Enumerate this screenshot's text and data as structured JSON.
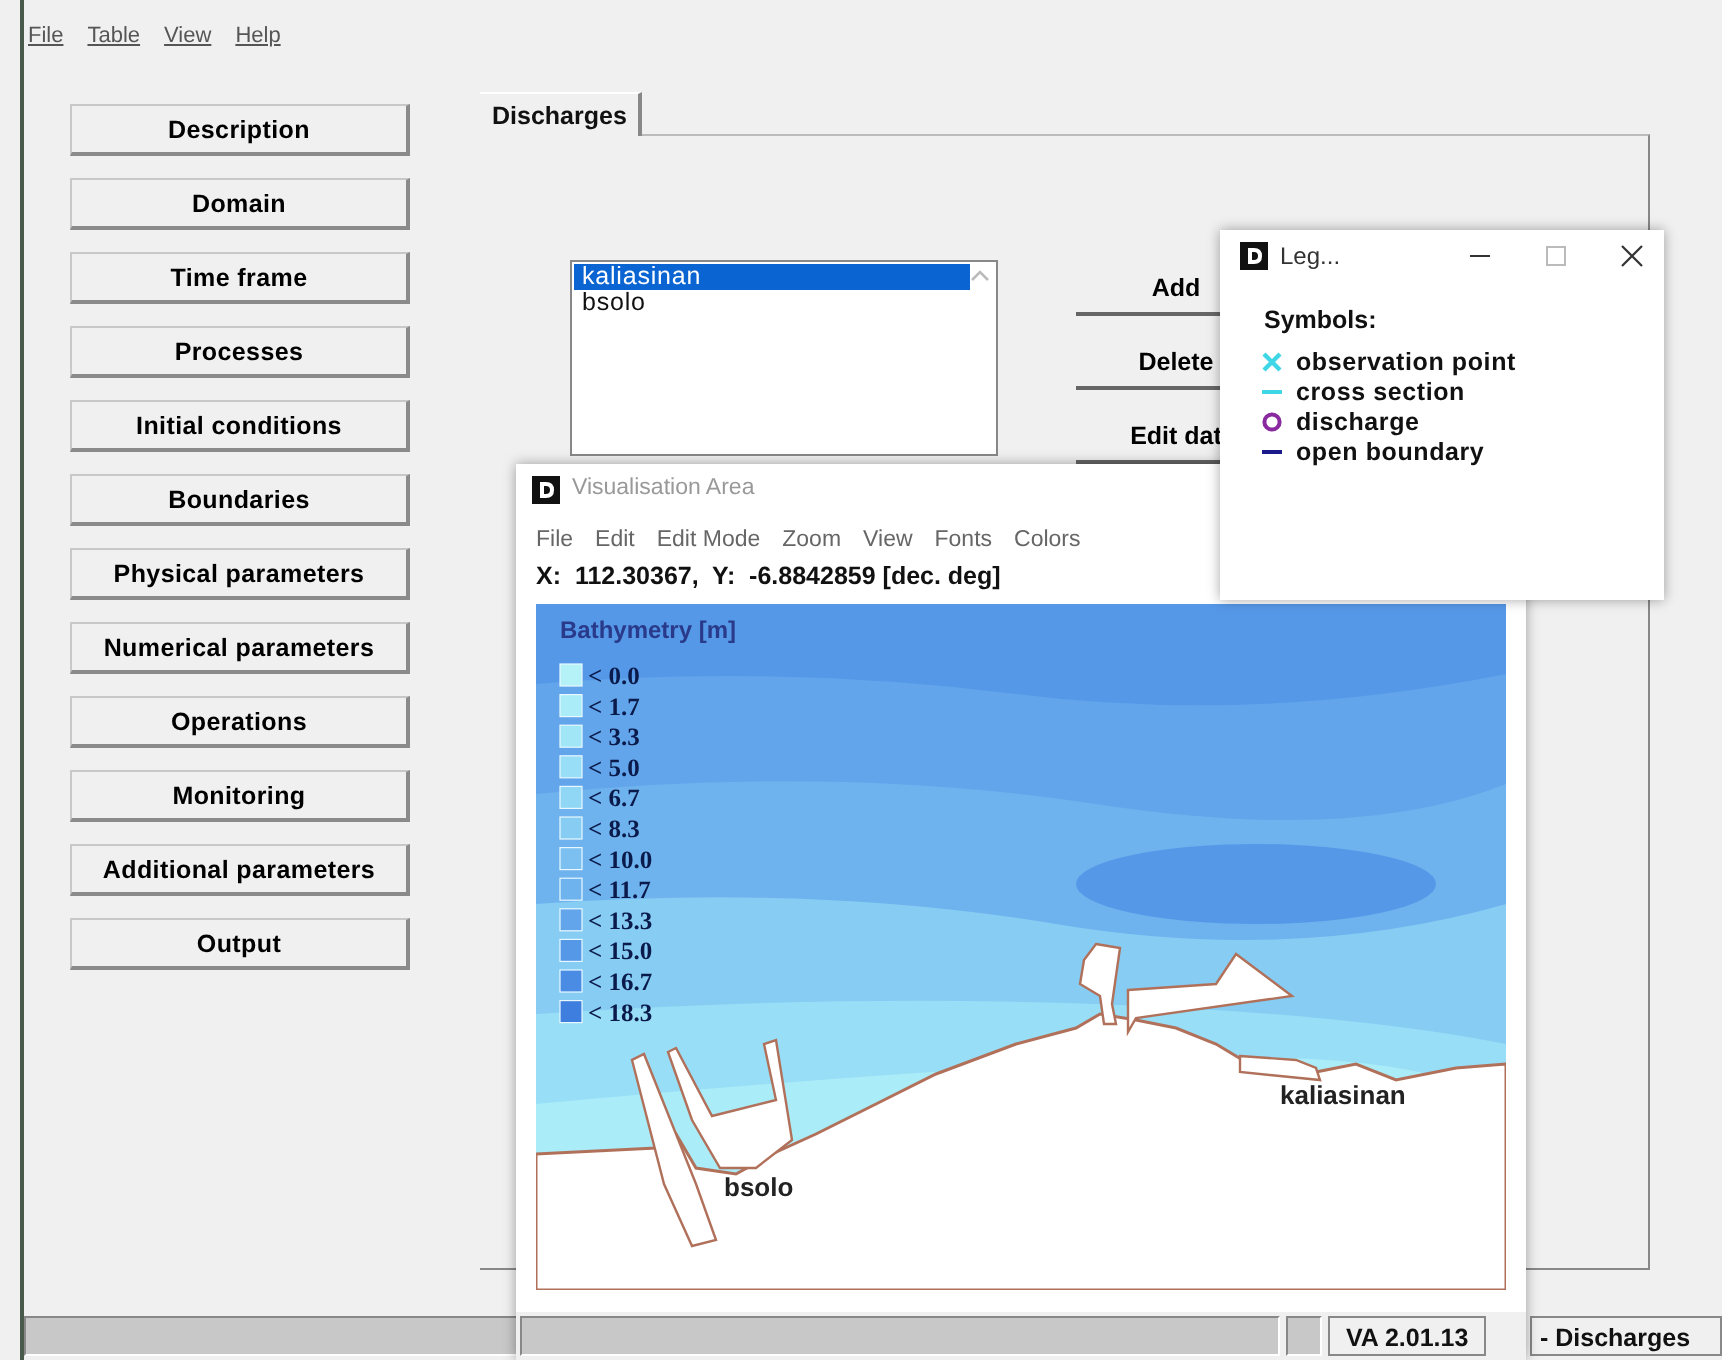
{
  "menu": [
    "File",
    "Table",
    "View",
    "Help"
  ],
  "sidebar": {
    "buttons": [
      "Description",
      "Domain",
      "Time frame",
      "Processes",
      "Initial conditions",
      "Boundaries",
      "Physical parameters",
      "Numerical parameters",
      "Operations",
      "Monitoring",
      "Additional parameters",
      "Output"
    ]
  },
  "tabs": [
    {
      "label": "Discharges",
      "selected": true
    }
  ],
  "discharge_list": [
    {
      "label": "kaliasinan",
      "selected": true
    },
    {
      "label": "bsolo",
      "selected": false
    }
  ],
  "action_buttons": [
    "Add",
    "Delete",
    "Edit dat"
  ],
  "status_bar": {
    "panel": "- Discharges"
  },
  "visualisation_window": {
    "title": "Visualisation Area",
    "menu": [
      "File",
      "Edit",
      "Edit Mode",
      "Zoom",
      "View",
      "Fonts",
      "Colors"
    ],
    "coordinates": "X:  112.30367,  Y:  -6.8842859 [dec. deg]",
    "map": {
      "legend_title": "Bathymetry [m]",
      "legend": [
        {
          "label": "< 0.0",
          "color": "#b4f2f8"
        },
        {
          "label": "< 1.7",
          "color": "#aaecf7"
        },
        {
          "label": "< 3.3",
          "color": "#a0e6f6"
        },
        {
          "label": "< 5.0",
          "color": "#98def6"
        },
        {
          "label": "< 6.7",
          "color": "#90d6f5"
        },
        {
          "label": "< 8.3",
          "color": "#86ccf3"
        },
        {
          "label": "< 10.0",
          "color": "#7cc0f1"
        },
        {
          "label": "< 11.7",
          "color": "#6eb2ee"
        },
        {
          "label": "< 13.3",
          "color": "#62a5eb"
        },
        {
          "label": "< 15.0",
          "color": "#5698e8"
        },
        {
          "label": "< 16.7",
          "color": "#4a8ce4"
        },
        {
          "label": "< 18.3",
          "color": "#3d7ede"
        }
      ],
      "places": [
        {
          "label": "bsolo"
        },
        {
          "label": "kaliasinan"
        }
      ]
    },
    "status_bar": {
      "version": "VA 2.01.13"
    }
  },
  "legend_window": {
    "title": "Leg...",
    "heading": "Symbols:",
    "symbols": [
      {
        "label": "observation point",
        "kind": "cross",
        "color": "#3fd6e6"
      },
      {
        "label": "cross section",
        "kind": "dash",
        "color": "#3fd6e6"
      },
      {
        "label": "discharge",
        "kind": "circle",
        "color": "#8a2aa0"
      },
      {
        "label": "open boundary",
        "kind": "dash",
        "color": "#1a1a8a"
      }
    ]
  }
}
